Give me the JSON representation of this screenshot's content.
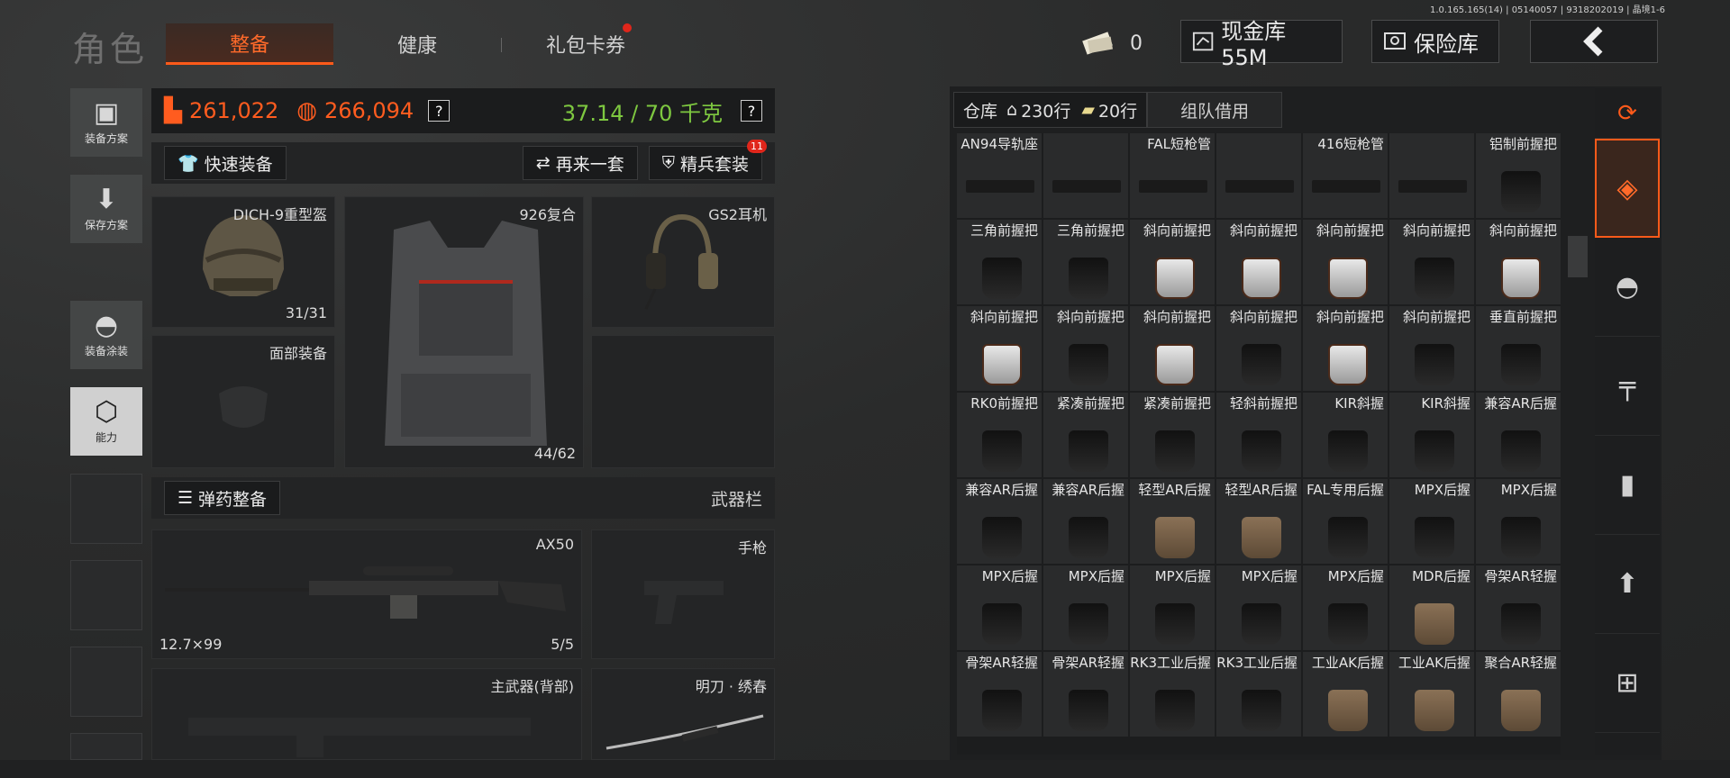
{
  "version": "1.0.165.165(14) | 05140057 | 9318202019 | 晶境1-6",
  "title": "角色",
  "tabs": [
    {
      "label": "整备",
      "active": true
    },
    {
      "label": "健康",
      "active": false
    },
    {
      "label": "礼包卡券",
      "active": false,
      "notify": true
    }
  ],
  "topbar": {
    "ticket_count": "0",
    "cash_label": "现金库 55M",
    "safe_label": "保险库",
    "back_icon": "chevron-left-icon"
  },
  "left_nav": [
    {
      "label": "装备方案",
      "icon": "vest-icon"
    },
    {
      "label": "保存方案",
      "icon": "download-icon"
    },
    {
      "label": "装备涂装",
      "icon": "helmet-paint-icon"
    },
    {
      "label": "能力",
      "icon": "hexagon-bolt-icon",
      "active": true
    }
  ],
  "stats": {
    "armor_value": "261,022",
    "bag_value": "266,094",
    "weight": "37.14 / 70 千克",
    "help": "?"
  },
  "actions": {
    "quick_equip": "快速装备",
    "again": "再来一套",
    "elite": "精兵套装",
    "elite_badge": "11"
  },
  "slots": {
    "helmet": {
      "name": "DICH-9重型盔",
      "count": "31/31"
    },
    "armor": {
      "name": "926复合",
      "count": "44/62"
    },
    "headset": {
      "name": "GS2耳机"
    },
    "face": {
      "name": "面部装备"
    }
  },
  "ammo_section": {
    "button": "弹药整备",
    "label": "武器栏"
  },
  "weapons": {
    "primary": {
      "name": "AX50",
      "caliber": "12.7×99",
      "ammo": "5/5"
    },
    "pistol": {
      "name": "手枪"
    },
    "back": {
      "name": "主武器(背部)"
    },
    "melee": {
      "name": "明刀 · 绣春"
    }
  },
  "warehouse": {
    "label": "仓库",
    "rows": "230行",
    "ticket_rows": "20行",
    "team_borrow": "组队借用",
    "items": [
      {
        "name": "AN94导轨座",
        "kind": "rail"
      },
      {
        "name": "",
        "kind": "rail"
      },
      {
        "name": "FAL短枪管",
        "kind": "rail"
      },
      {
        "name": "",
        "kind": "rail"
      },
      {
        "name": "416短枪管",
        "kind": "rail"
      },
      {
        "name": "",
        "kind": "rail"
      },
      {
        "name": "铝制前握把",
        "kind": "black"
      },
      {
        "name": "三角前握把",
        "kind": "black"
      },
      {
        "name": "三角前握把",
        "kind": "black"
      },
      {
        "name": "斜向前握把",
        "kind": "silver"
      },
      {
        "name": "斜向前握把",
        "kind": "silver"
      },
      {
        "name": "斜向前握把",
        "kind": "silver"
      },
      {
        "name": "斜向前握把",
        "kind": "black"
      },
      {
        "name": "斜向前握把",
        "kind": "silver"
      },
      {
        "name": "斜向前握把",
        "kind": "silver"
      },
      {
        "name": "斜向前握把",
        "kind": "black"
      },
      {
        "name": "斜向前握把",
        "kind": "silver"
      },
      {
        "name": "斜向前握把",
        "kind": "black"
      },
      {
        "name": "斜向前握把",
        "kind": "silver"
      },
      {
        "name": "斜向前握把",
        "kind": "black"
      },
      {
        "name": "垂直前握把",
        "kind": "black"
      },
      {
        "name": "RK0前握把",
        "kind": "black"
      },
      {
        "name": "紧凑前握把",
        "kind": "black"
      },
      {
        "name": "紧凑前握把",
        "kind": "black"
      },
      {
        "name": "轻斜前握把",
        "kind": "black"
      },
      {
        "name": "KIR斜握",
        "kind": "black"
      },
      {
        "name": "KIR斜握",
        "kind": "black"
      },
      {
        "name": "兼容AR后握",
        "kind": "black"
      },
      {
        "name": "兼容AR后握",
        "kind": "black"
      },
      {
        "name": "兼容AR后握",
        "kind": "black"
      },
      {
        "name": "轻型AR后握",
        "kind": "tan"
      },
      {
        "name": "轻型AR后握",
        "kind": "tan"
      },
      {
        "name": "FAL专用后握",
        "kind": "black"
      },
      {
        "name": "MPX后握",
        "kind": "black"
      },
      {
        "name": "MPX后握",
        "kind": "black"
      },
      {
        "name": "MPX后握",
        "kind": "black"
      },
      {
        "name": "MPX后握",
        "kind": "black"
      },
      {
        "name": "MPX后握",
        "kind": "black"
      },
      {
        "name": "MPX后握",
        "kind": "black"
      },
      {
        "name": "MPX后握",
        "kind": "black"
      },
      {
        "name": "MDR后握",
        "kind": "tan"
      },
      {
        "name": "骨架AR轻握",
        "kind": "black"
      },
      {
        "name": "骨架AR轻握",
        "kind": "black"
      },
      {
        "name": "骨架AR轻握",
        "kind": "black"
      },
      {
        "name": "RK3工业后握",
        "kind": "black"
      },
      {
        "name": "RK3工业后握",
        "kind": "black"
      },
      {
        "name": "工业AK后握",
        "kind": "tan"
      },
      {
        "name": "工业AK后握",
        "kind": "tan"
      },
      {
        "name": "聚合AR轻握",
        "kind": "tan"
      }
    ]
  },
  "right_nav": [
    "refresh-stack-icon",
    "stack-icon",
    "helmet-icon",
    "rifle-icon",
    "magazine-icon",
    "bullet-icon",
    "sight-icon"
  ],
  "colors": {
    "accent": "#ff5a1a",
    "weight_ok": "#7ec840"
  }
}
